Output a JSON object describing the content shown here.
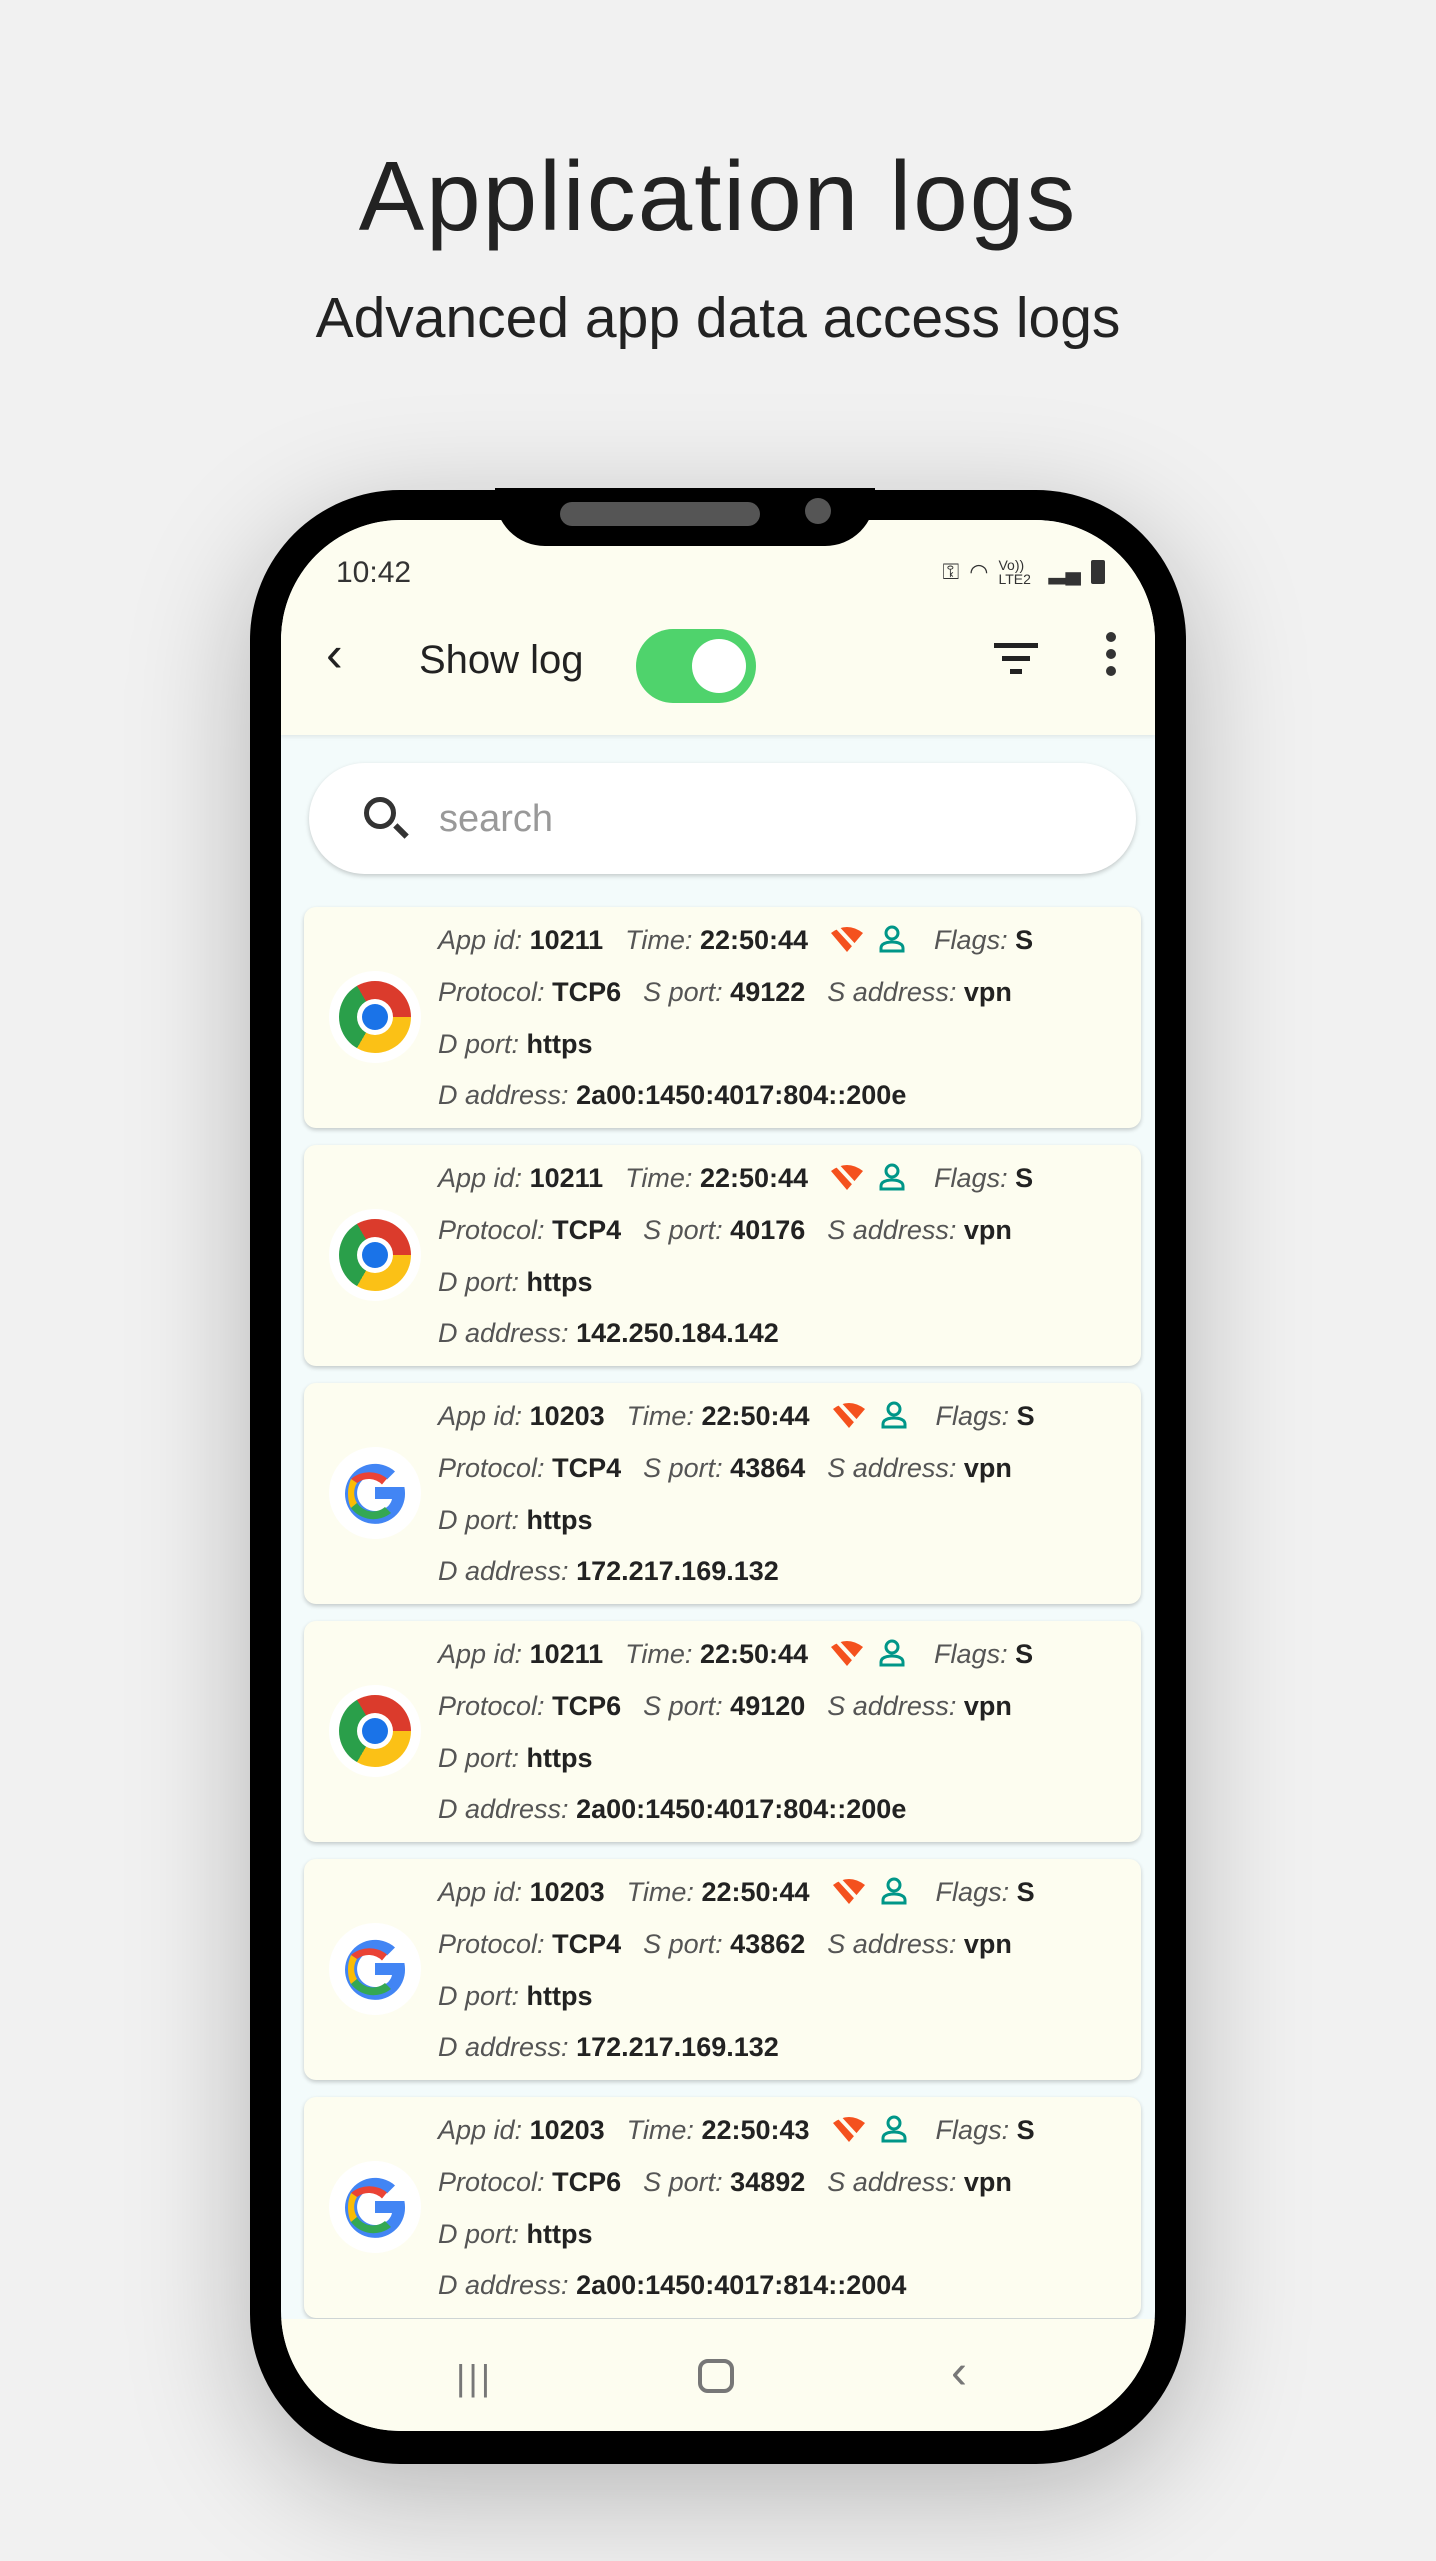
{
  "header": {
    "title": "Application logs",
    "subtitle": "Advanced app data access logs"
  },
  "status_bar": {
    "time": "10:42",
    "network": "Vo)) LTE2"
  },
  "toolbar": {
    "title": "Show log",
    "show_log_enabled": true,
    "toggle_color": "#4fd36c"
  },
  "search": {
    "placeholder": "search",
    "value": ""
  },
  "labels": {
    "app_id": "App id:",
    "time": "Time:",
    "flags": "Flags:",
    "protocol": "Protocol:",
    "s_port": "S port:",
    "s_address": "S address:",
    "d_port": "D port:",
    "d_address": "D address:"
  },
  "logs": [
    {
      "app_icon": "chrome",
      "app_id": "10211",
      "time": "22:50:44",
      "flags": "S",
      "protocol": "TCP6",
      "s_port": "49122",
      "s_address": "vpn",
      "d_port": "https",
      "d_address": "2a00:1450:4017:804::200e"
    },
    {
      "app_icon": "chrome",
      "app_id": "10211",
      "time": "22:50:44",
      "flags": "S",
      "protocol": "TCP4",
      "s_port": "40176",
      "s_address": "vpn",
      "d_port": "https",
      "d_address": "142.250.184.142"
    },
    {
      "app_icon": "google",
      "app_id": "10203",
      "time": "22:50:44",
      "flags": "S",
      "protocol": "TCP4",
      "s_port": "43864",
      "s_address": "vpn",
      "d_port": "https",
      "d_address": "172.217.169.132"
    },
    {
      "app_icon": "chrome",
      "app_id": "10211",
      "time": "22:50:44",
      "flags": "S",
      "protocol": "TCP6",
      "s_port": "49120",
      "s_address": "vpn",
      "d_port": "https",
      "d_address": "2a00:1450:4017:804::200e"
    },
    {
      "app_icon": "google",
      "app_id": "10203",
      "time": "22:50:44",
      "flags": "S",
      "protocol": "TCP4",
      "s_port": "43862",
      "s_address": "vpn",
      "d_port": "https",
      "d_address": "172.217.169.132"
    },
    {
      "app_icon": "google",
      "app_id": "10203",
      "time": "22:50:43",
      "flags": "S",
      "protocol": "TCP6",
      "s_port": "34892",
      "s_address": "vpn",
      "d_port": "https",
      "d_address": "2a00:1450:4017:814::2004"
    }
  ],
  "colors": {
    "wifi_off": "#f4511e",
    "user": "#009688",
    "card_bg": "#fdfdf0"
  }
}
